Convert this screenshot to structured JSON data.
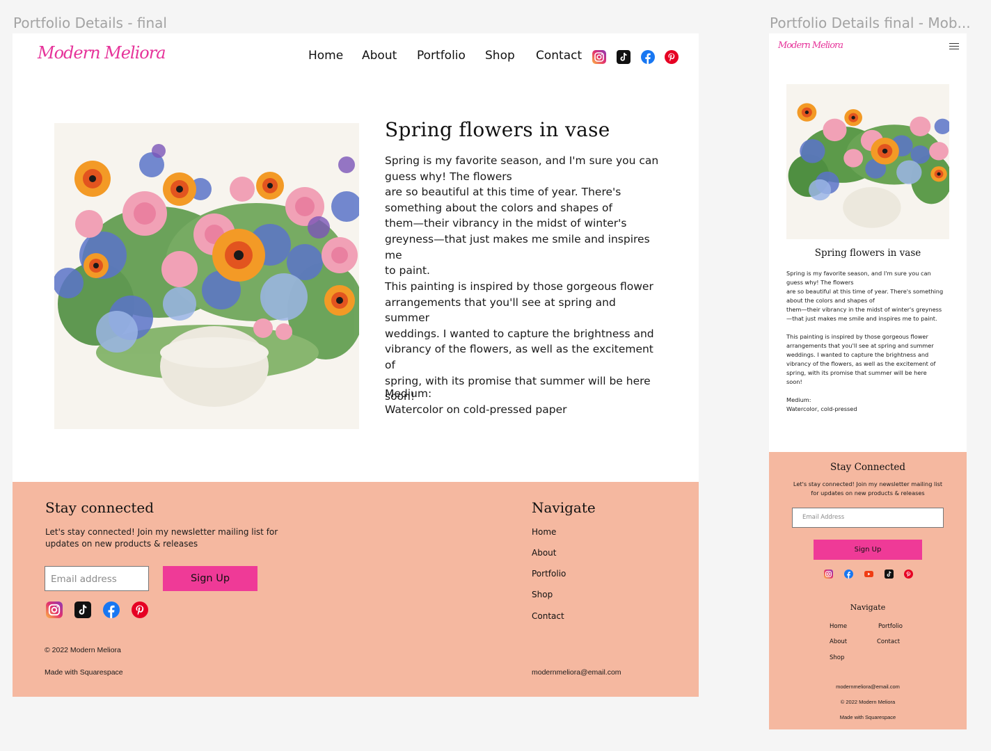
{
  "frames": {
    "desktop_label": "Portfolio Details - final",
    "mobile_label": "Portfolio Details final - Mob..."
  },
  "brand": {
    "logo": "Modern Meliora",
    "accent": "#ef3a97",
    "logo_color": "#e6339a",
    "footer_bg": "#f5b8a0"
  },
  "nav": {
    "items": [
      "Home",
      "About",
      "Portfolio",
      "Shop",
      "Contact"
    ],
    "social_icons": [
      "instagram-icon",
      "tiktok-icon",
      "facebook-icon",
      "pinterest-icon"
    ]
  },
  "artwork": {
    "title": "Spring flowers in vase",
    "para1_lines": [
      "Spring is my favorite season, and I'm sure you can",
      "guess why! The flowers",
      "are so beautiful at this time of year. There's",
      "something about the colors and shapes of",
      "them—their vibrancy in the midst of winter's",
      "greyness—that just makes me smile and inspires me",
      "to paint."
    ],
    "para2_lines": [
      "This painting is inspired by those gorgeous flower",
      "arrangements that you'll see at spring and summer",
      "weddings. I wanted to capture the brightness and",
      "vibrancy of the flowers, as well as the excitement of",
      "spring, with its promise that summer will be here",
      "soon!"
    ],
    "medium_label": "Medium:",
    "medium_value": "Watercolor on cold-pressed paper"
  },
  "footer": {
    "stay_heading": "Stay connected",
    "stay_text_lines": [
      "Let's stay connected! Join my newsletter mailing list for",
      "updates on new products & releases"
    ],
    "email_placeholder": "Email address",
    "signup_label": "Sign Up",
    "social_icons": [
      "instagram-icon",
      "tiktok-icon",
      "facebook-icon",
      "pinterest-icon"
    ],
    "copyright": "© 2022 Modern Meliora",
    "made_with": "Made with Squarespace",
    "navigate_heading": "Navigate",
    "nav_links": [
      "Home",
      "About",
      "Portfolio",
      "Shop",
      "Contact"
    ],
    "email": "modernmeliora@email.com"
  },
  "mobile": {
    "title": "Spring flowers in vase",
    "para1_lines": [
      "Spring is my favorite season, and I'm sure you can",
      "guess why! The flowers",
      "are so beautiful at this time of year. There's something",
      "about the colors and shapes of",
      "them—their vibrancy in the midst of winter's greyness",
      "—that just makes me smile and inspires me to paint."
    ],
    "para2_lines": [
      "This painting is inspired by those gorgeous flower",
      "arrangements that you'll see at spring and summer",
      "weddings. I wanted to capture the brightness and",
      "vibrancy of the flowers, as well as the excitement of",
      "spring, with its promise that summer will be here",
      "soon!"
    ],
    "medium_label": "Medium:",
    "medium_value": "Watercolor, cold-pressed",
    "footer": {
      "stay_heading": "Stay Connected",
      "stay_text_lines": [
        "Let's stay connected! Join my newsletter mailing list",
        "for updates on new products & releases"
      ],
      "email_placeholder": "Email Address",
      "signup_label": "Sign Up",
      "social_icons": [
        "instagram-icon",
        "facebook-icon",
        "youtube-icon",
        "tiktok-icon",
        "pinterest-icon"
      ],
      "navigate_heading": "Navigate",
      "nav_col1": [
        "Home",
        "About",
        "Shop"
      ],
      "nav_col2": [
        "Portfolio",
        "Contact"
      ],
      "email": "modernmeliora@email.com",
      "copyright": "© 2022 Modern Meliora",
      "made_with": "Made with Squarespace"
    }
  }
}
